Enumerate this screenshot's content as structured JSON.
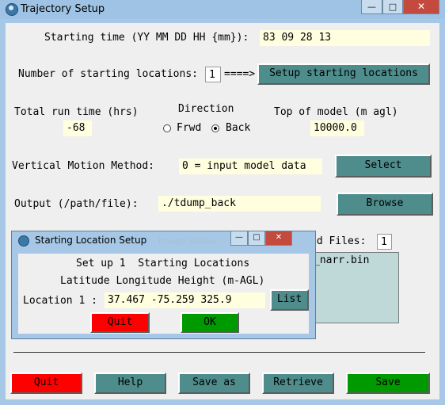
{
  "window": {
    "title": "Trajectory Setup",
    "controls": {
      "minimize": "—",
      "maximize": "□",
      "close": "✕"
    }
  },
  "start_time": {
    "label": "Starting time (YY MM DD HH {mm}):",
    "value": "83 09 28 13"
  },
  "num_locations": {
    "label": "Number of starting locations:",
    "value": "1",
    "arrow": "====>",
    "button": "Setup starting locations"
  },
  "run_time": {
    "label": "Total run time (hrs)",
    "value": "-68"
  },
  "direction": {
    "label": "Direction",
    "options": [
      "Frwd",
      "Back"
    ],
    "selected": "Back"
  },
  "top_of_model": {
    "label": "Top of model (m agl)",
    "value": "10000.0"
  },
  "vertical_motion": {
    "label": "Vertical Motion Method:",
    "value": "0 = input model data",
    "button": "Select"
  },
  "output": {
    "label": "Output (/path/file):",
    "value": "./tdump_back",
    "button": "Browse"
  },
  "files": {
    "label_partial": "ed Files:",
    "count": "1",
    "list_item_partial": "_narr.bin"
  },
  "bottom_buttons": {
    "quit": "Quit",
    "help": "Help",
    "save_as": "Save as",
    "retrieve": "Retrieve",
    "save": "Save"
  },
  "dialog": {
    "title": "Starting Location Setup",
    "ghost_title": "Image Widow",
    "controls": {
      "minimize": "—",
      "maximize": "□",
      "close": "✕"
    },
    "heading1": "Set up 1  Starting Locations",
    "heading2": "Latitude Longitude Height (m-AGL)",
    "location_label": "Location 1 :",
    "location_value": "37.467 -75.259 325.9",
    "list_button": "List",
    "quit_button": "Quit",
    "ok_button": "OK"
  },
  "colors": {
    "quit": "#ff0000",
    "save": "#009900",
    "teal": "#4f8c8c",
    "field": "#ffffe0",
    "titlebar": "#9fc3e4"
  }
}
